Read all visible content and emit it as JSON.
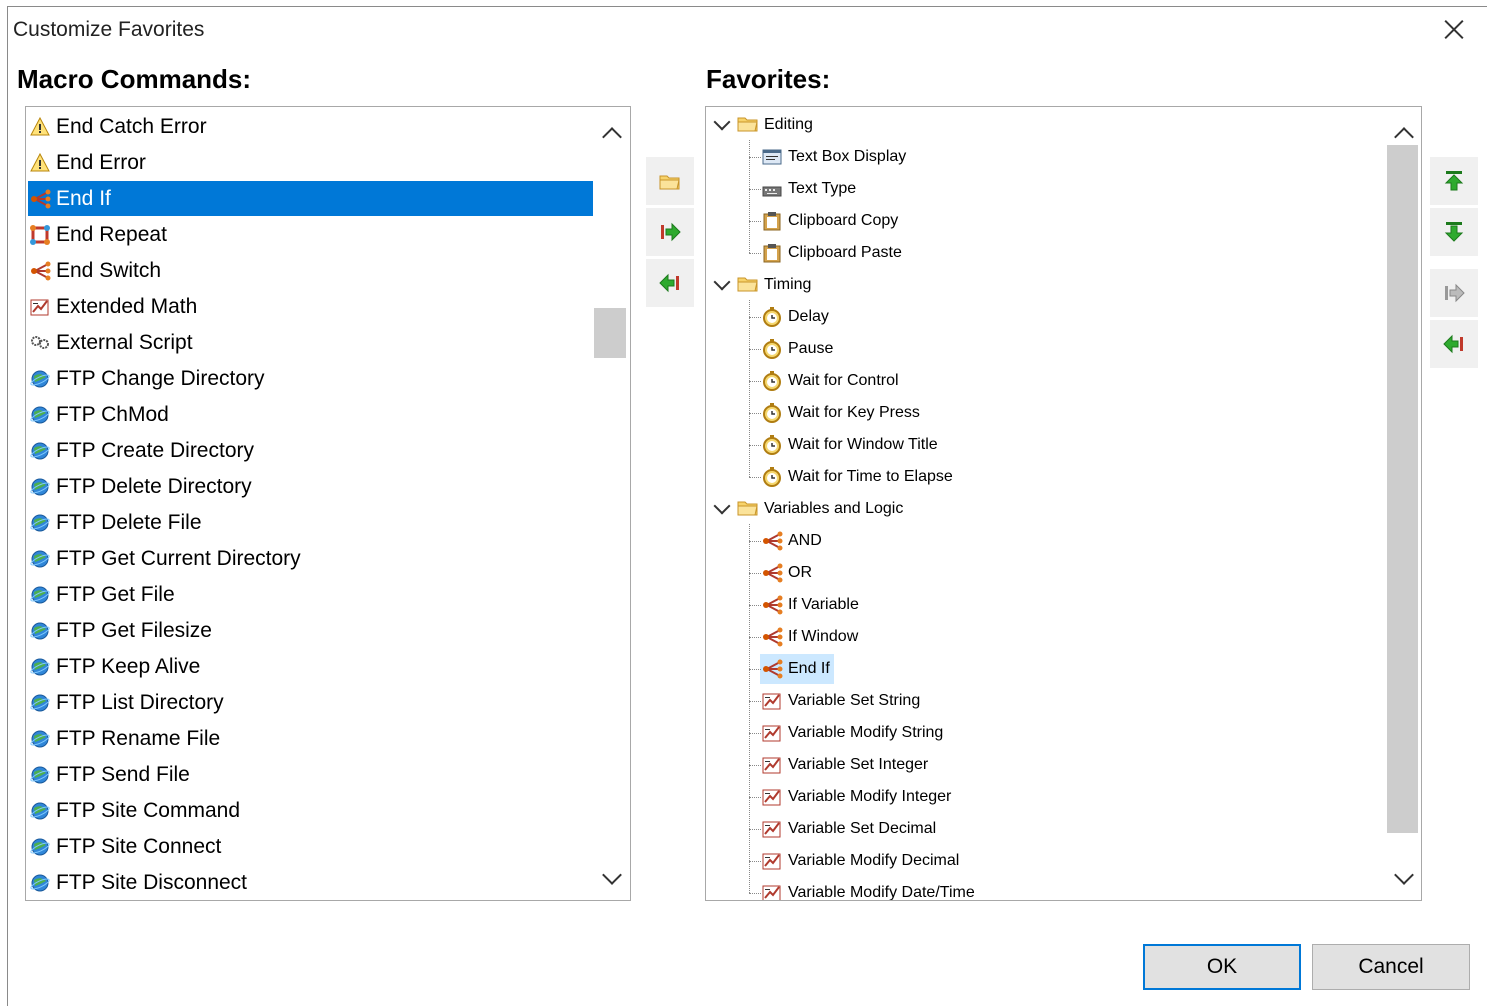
{
  "window": {
    "title": "Customize Favorites"
  },
  "left_header": "Macro Commands:",
  "right_header": "Favorites:",
  "macro_commands": [
    {
      "label": "End Catch Error",
      "icon": "warning-icon"
    },
    {
      "label": "End Error",
      "icon": "warning-icon"
    },
    {
      "label": "End If",
      "icon": "branch-icon",
      "selected": true
    },
    {
      "label": "End Repeat",
      "icon": "repeat-icon"
    },
    {
      "label": "End Switch",
      "icon": "branch-icon"
    },
    {
      "label": "Extended Math",
      "icon": "math-icon"
    },
    {
      "label": "External Script",
      "icon": "script-icon"
    },
    {
      "label": "FTP Change Directory",
      "icon": "globe-icon"
    },
    {
      "label": "FTP ChMod",
      "icon": "globe-icon"
    },
    {
      "label": "FTP Create Directory",
      "icon": "globe-icon"
    },
    {
      "label": "FTP Delete Directory",
      "icon": "globe-icon"
    },
    {
      "label": "FTP Delete File",
      "icon": "globe-icon"
    },
    {
      "label": "FTP Get Current Directory",
      "icon": "globe-icon"
    },
    {
      "label": "FTP Get File",
      "icon": "globe-icon"
    },
    {
      "label": "FTP Get Filesize",
      "icon": "globe-icon"
    },
    {
      "label": "FTP Keep Alive",
      "icon": "globe-icon"
    },
    {
      "label": "FTP List Directory",
      "icon": "globe-icon"
    },
    {
      "label": "FTP Rename File",
      "icon": "globe-icon"
    },
    {
      "label": "FTP Send File",
      "icon": "globe-icon"
    },
    {
      "label": "FTP Site Command",
      "icon": "globe-icon"
    },
    {
      "label": "FTP Site Connect",
      "icon": "globe-icon"
    },
    {
      "label": "FTP Site Disconnect",
      "icon": "globe-icon"
    }
  ],
  "favorites": [
    {
      "folder": "Editing",
      "items": [
        {
          "label": "Text Box Display",
          "icon": "textbox-icon"
        },
        {
          "label": "Text Type",
          "icon": "keyboard-icon"
        },
        {
          "label": "Clipboard Copy",
          "icon": "clipboard-icon"
        },
        {
          "label": "Clipboard Paste",
          "icon": "clipboard-icon"
        }
      ]
    },
    {
      "folder": "Timing",
      "items": [
        {
          "label": "Delay",
          "icon": "clock-icon"
        },
        {
          "label": "Pause",
          "icon": "clock-icon"
        },
        {
          "label": "Wait for Control",
          "icon": "clock-icon"
        },
        {
          "label": "Wait for Key Press",
          "icon": "clock-icon"
        },
        {
          "label": "Wait for Window Title",
          "icon": "clock-icon"
        },
        {
          "label": "Wait for Time to Elapse",
          "icon": "clock-icon"
        }
      ]
    },
    {
      "folder": "Variables and Logic",
      "items": [
        {
          "label": "AND",
          "icon": "branch-icon"
        },
        {
          "label": "OR",
          "icon": "branch-icon"
        },
        {
          "label": "If Variable",
          "icon": "branch-icon"
        },
        {
          "label": "If Window",
          "icon": "branch-icon"
        },
        {
          "label": "End If",
          "icon": "branch-icon",
          "highlighted": true
        },
        {
          "label": "Variable Set String",
          "icon": "math-icon"
        },
        {
          "label": "Variable Modify String",
          "icon": "math-icon"
        },
        {
          "label": "Variable Set Integer",
          "icon": "math-icon"
        },
        {
          "label": "Variable Modify Integer",
          "icon": "math-icon"
        },
        {
          "label": "Variable Set Decimal",
          "icon": "math-icon"
        },
        {
          "label": "Variable Modify Decimal",
          "icon": "math-icon"
        },
        {
          "label": "Variable Modify Date/Time",
          "icon": "math-icon"
        }
      ]
    }
  ],
  "middle_buttons": [
    "new-folder-icon",
    "add-to-favorites-icon",
    "remove-from-favorites-icon"
  ],
  "right_buttons": [
    "move-up-icon",
    "move-down-icon",
    "indent-icon",
    "outdent-icon"
  ],
  "buttons": {
    "ok": "OK",
    "cancel": "Cancel"
  },
  "colors": {
    "selection": "#0078d7",
    "highlight": "#cce8ff",
    "default_button_border": "#0078d7"
  }
}
